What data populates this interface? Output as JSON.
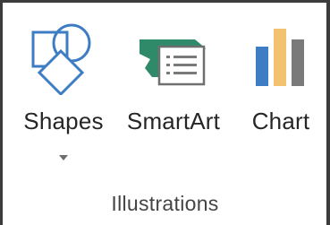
{
  "group": {
    "title": "Illustrations"
  },
  "buttons": [
    {
      "label": "Shapes",
      "icon": "shapes-icon",
      "has_dropdown": true
    },
    {
      "label": "SmartArt",
      "icon": "smartart-icon",
      "has_dropdown": false
    },
    {
      "label": "Chart",
      "icon": "chart-icon",
      "has_dropdown": false
    }
  ],
  "colors": {
    "shape_blue": "#3e7cc4",
    "smartart_teal": "#2f8a6a",
    "chart_blue": "#3e7cc4",
    "chart_yellow": "#f2c270",
    "chart_gray": "#7a7a7a",
    "text": "#262626",
    "border": "#3c3c3c"
  }
}
